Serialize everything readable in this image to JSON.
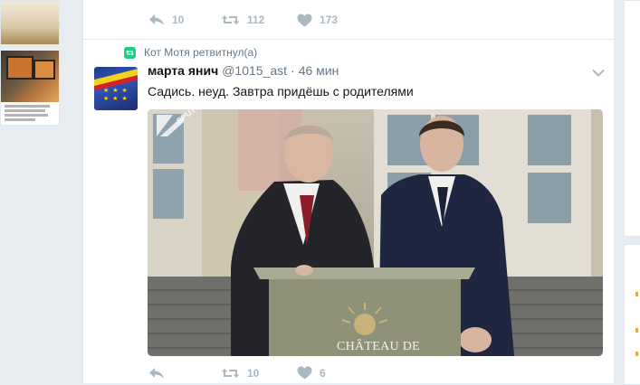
{
  "previous_tweet": {
    "actions": {
      "reply": {
        "icon": "reply-icon",
        "count": "10"
      },
      "retweet": {
        "icon": "retweet-icon",
        "count": "112"
      },
      "like": {
        "icon": "heart-icon",
        "count": "173"
      }
    }
  },
  "tweet": {
    "retweet_context": {
      "icon": "retweet-badge-icon",
      "text": "Кот Мотя ретвитнул(а)"
    },
    "author": {
      "name": "марта янич",
      "handle": "@1015_ast",
      "separator": "·",
      "time": "46 мин"
    },
    "text": "Садись. неуд. Завтра придёшь с родителями",
    "media": {
      "watermark": "SPUTNIK",
      "podium_caption": "CHÂTEAU DE VERSAILLES"
    },
    "actions": {
      "reply": {
        "icon": "reply-icon",
        "count": ""
      },
      "retweet": {
        "icon": "retweet-icon",
        "count": "10"
      },
      "like": {
        "icon": "heart-icon",
        "count": "6"
      }
    }
  },
  "colors": {
    "action_gray": "#aab8c2",
    "retweet_green": "#19cf86",
    "secondary_text": "#657786",
    "page_bg": "#e6ecf0"
  }
}
